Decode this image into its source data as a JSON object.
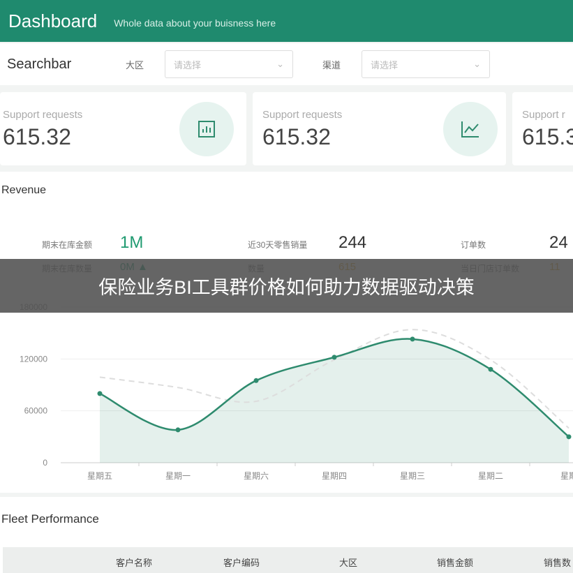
{
  "header": {
    "title": "Dashboard",
    "subtitle": "Whole data about your buisness here"
  },
  "searchbar": {
    "title": "Searchbar",
    "filters": [
      {
        "label": "大区",
        "placeholder": "请选择"
      },
      {
        "label": "渠道",
        "placeholder": "请选择"
      }
    ]
  },
  "cards": [
    {
      "label": "Support requests",
      "value": "615.32",
      "icon": "bar-chart-icon"
    },
    {
      "label": "Support requests",
      "value": "615.32",
      "icon": "line-chart-icon"
    },
    {
      "label": "Support r",
      "value": "615.3"
    }
  ],
  "revenue": {
    "title": "Revenue",
    "kpis": [
      {
        "label": "期末在库金额",
        "value": "1M",
        "color": "#1f9a70"
      },
      {
        "label": "近30天零售销量",
        "value": "244",
        "color": "#333333"
      },
      {
        "label": "订单数",
        "value": "24",
        "color": "#333333"
      },
      {
        "label": "期末在库数量",
        "value": "0M ▲",
        "color": "#1f9a70"
      },
      {
        "label": "数量",
        "value": "615",
        "color": "#d9a22a"
      },
      {
        "label": "当日门店订单数",
        "value": "11",
        "color": "#d9a22a"
      }
    ]
  },
  "banner": "保险业务BI工具群价格如何助力数据驱动决策",
  "chart_data": {
    "type": "area",
    "categories": [
      "星期五",
      "星期一",
      "星期六",
      "星期四",
      "星期三",
      "星期二",
      "星期"
    ],
    "ylim": [
      0,
      180000
    ],
    "yticks": [
      "0",
      "60000",
      "120000",
      "180000"
    ],
    "grid": true,
    "series": [
      {
        "values": [
          80000,
          38000,
          95000,
          122000,
          143000,
          108000,
          30000
        ],
        "color": "#2e8b6e",
        "style": "solid-area"
      },
      {
        "values": [
          99000,
          87000,
          71000,
          119000,
          154000,
          119000,
          40000
        ],
        "color": "#dddddd",
        "style": "dashed"
      }
    ]
  },
  "fleet": {
    "title": "Fleet Performance",
    "columns": [
      "客户名称",
      "客户编码",
      "大区",
      "销售金额",
      "销售数"
    ]
  }
}
